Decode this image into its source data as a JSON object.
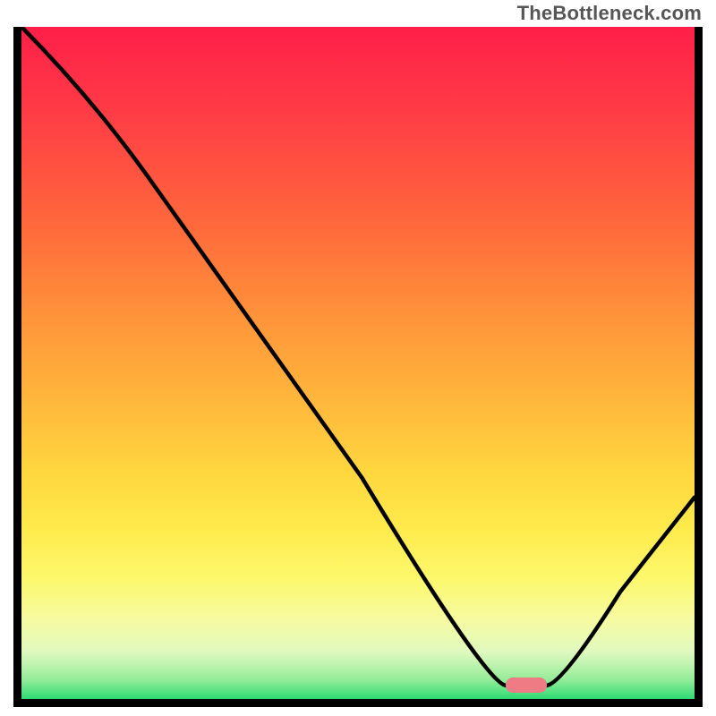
{
  "attribution": "TheBottleneck.com",
  "colors": {
    "gradient_top": "#ff1f48",
    "gradient_mid": "#ffd63e",
    "gradient_bottom": "#2fdc74",
    "curve": "#000000",
    "marker": "#ef7c85",
    "border": "#000000"
  },
  "chart_data": {
    "type": "line",
    "title": "",
    "xlabel": "",
    "ylabel": "",
    "xlim": [
      0,
      100
    ],
    "ylim": [
      0,
      100
    ],
    "x": [
      0,
      20,
      72,
      78,
      100
    ],
    "values": [
      100,
      76,
      2,
      2,
      30
    ],
    "marker": {
      "x_start": 72,
      "x_end": 78,
      "y": 2
    },
    "annotations": []
  }
}
